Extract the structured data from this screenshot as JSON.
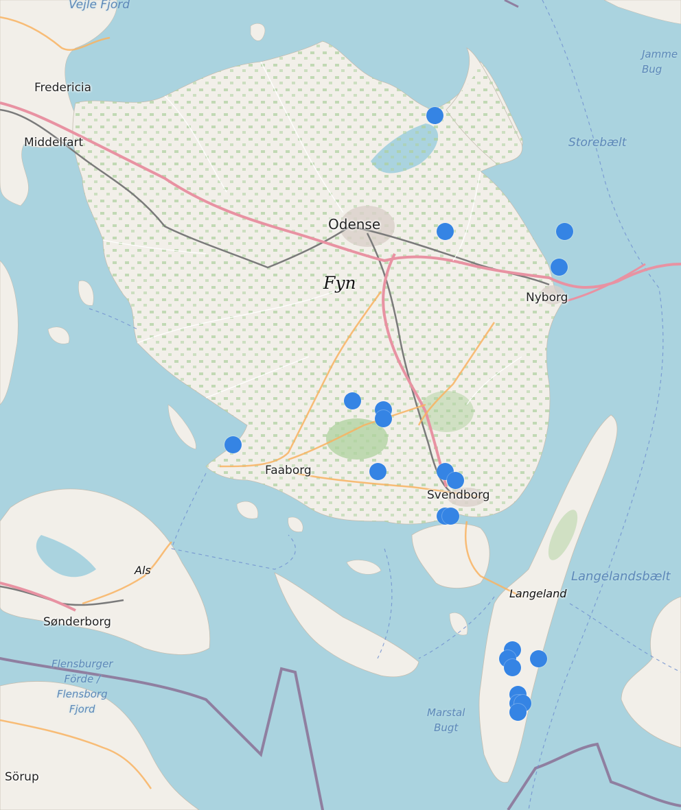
{
  "map": {
    "labels": {
      "fredericia": "Fredericia",
      "middelfart": "Middelfart",
      "odense": "Odense",
      "fyn": "Fyn",
      "nyborg": "Nyborg",
      "faaborg": "Faaborg",
      "svendborg": "Svendborg",
      "als": "Als",
      "sonderborg": "Sønderborg",
      "langeland": "Langeland",
      "sorup": "Sörup",
      "vejle_fjord": "Vejle Fjord",
      "storebaelt": "Storebælt",
      "jammer_bugt": "Jamme\nBug",
      "langelandsbaelt": "Langelandsbælt",
      "marstal_bugt": "Marstal\nBugt",
      "flensburger_forde": "Flensburger\nFörde /\nFlensborg\nFjord"
    },
    "colors": {
      "water": "#aad3df",
      "land": "#f2efe9",
      "forest": "#add19e",
      "motorway": "#e892a2",
      "primary_road": "#fcd6a4",
      "railway": "#888888",
      "boundary": "#8f7fa0",
      "marker": "#3584e4"
    },
    "markers": [
      {
        "name": "Kerteminde Fjord area",
        "lat": 55.47,
        "lon": 10.57
      },
      {
        "name": "Near Odense SE",
        "lat": 55.34,
        "lon": 10.59
      },
      {
        "name": "Nyborg north coast",
        "lat": 55.34,
        "lon": 10.82
      },
      {
        "name": "Nyborg",
        "lat": 55.3,
        "lon": 10.81
      },
      {
        "name": "Central Fyn west",
        "lat": 55.15,
        "lon": 10.41
      },
      {
        "name": "Central Fyn",
        "lat": 55.14,
        "lon": 10.47
      },
      {
        "name": "Central Fyn south",
        "lat": 55.13,
        "lon": 10.47
      },
      {
        "name": "Horne Land",
        "lat": 55.1,
        "lon": 10.18
      },
      {
        "name": "Faaborg east coast",
        "lat": 55.07,
        "lon": 10.46
      },
      {
        "name": "Svendborg west",
        "lat": 55.07,
        "lon": 10.59
      },
      {
        "name": "Svendborg",
        "lat": 55.06,
        "lon": 10.61
      },
      {
        "name": "Tåsinge west 1",
        "lat": 55.02,
        "lon": 10.59
      },
      {
        "name": "Tåsinge west 2",
        "lat": 55.02,
        "lon": 10.6
      },
      {
        "name": "Langeland south 1",
        "lat": 54.87,
        "lon": 10.72
      },
      {
        "name": "Langeland south 2",
        "lat": 54.86,
        "lon": 10.71
      },
      {
        "name": "Langeland south 3",
        "lat": 54.85,
        "lon": 10.72
      },
      {
        "name": "Langeland south-east",
        "lat": 54.86,
        "lon": 10.77
      },
      {
        "name": "Langeland tip 1",
        "lat": 54.82,
        "lon": 10.73
      },
      {
        "name": "Langeland tip 2",
        "lat": 54.81,
        "lon": 10.73
      },
      {
        "name": "Langeland tip 3",
        "lat": 54.81,
        "lon": 10.74
      },
      {
        "name": "Langeland tip 4",
        "lat": 54.8,
        "lon": 10.73
      }
    ]
  }
}
